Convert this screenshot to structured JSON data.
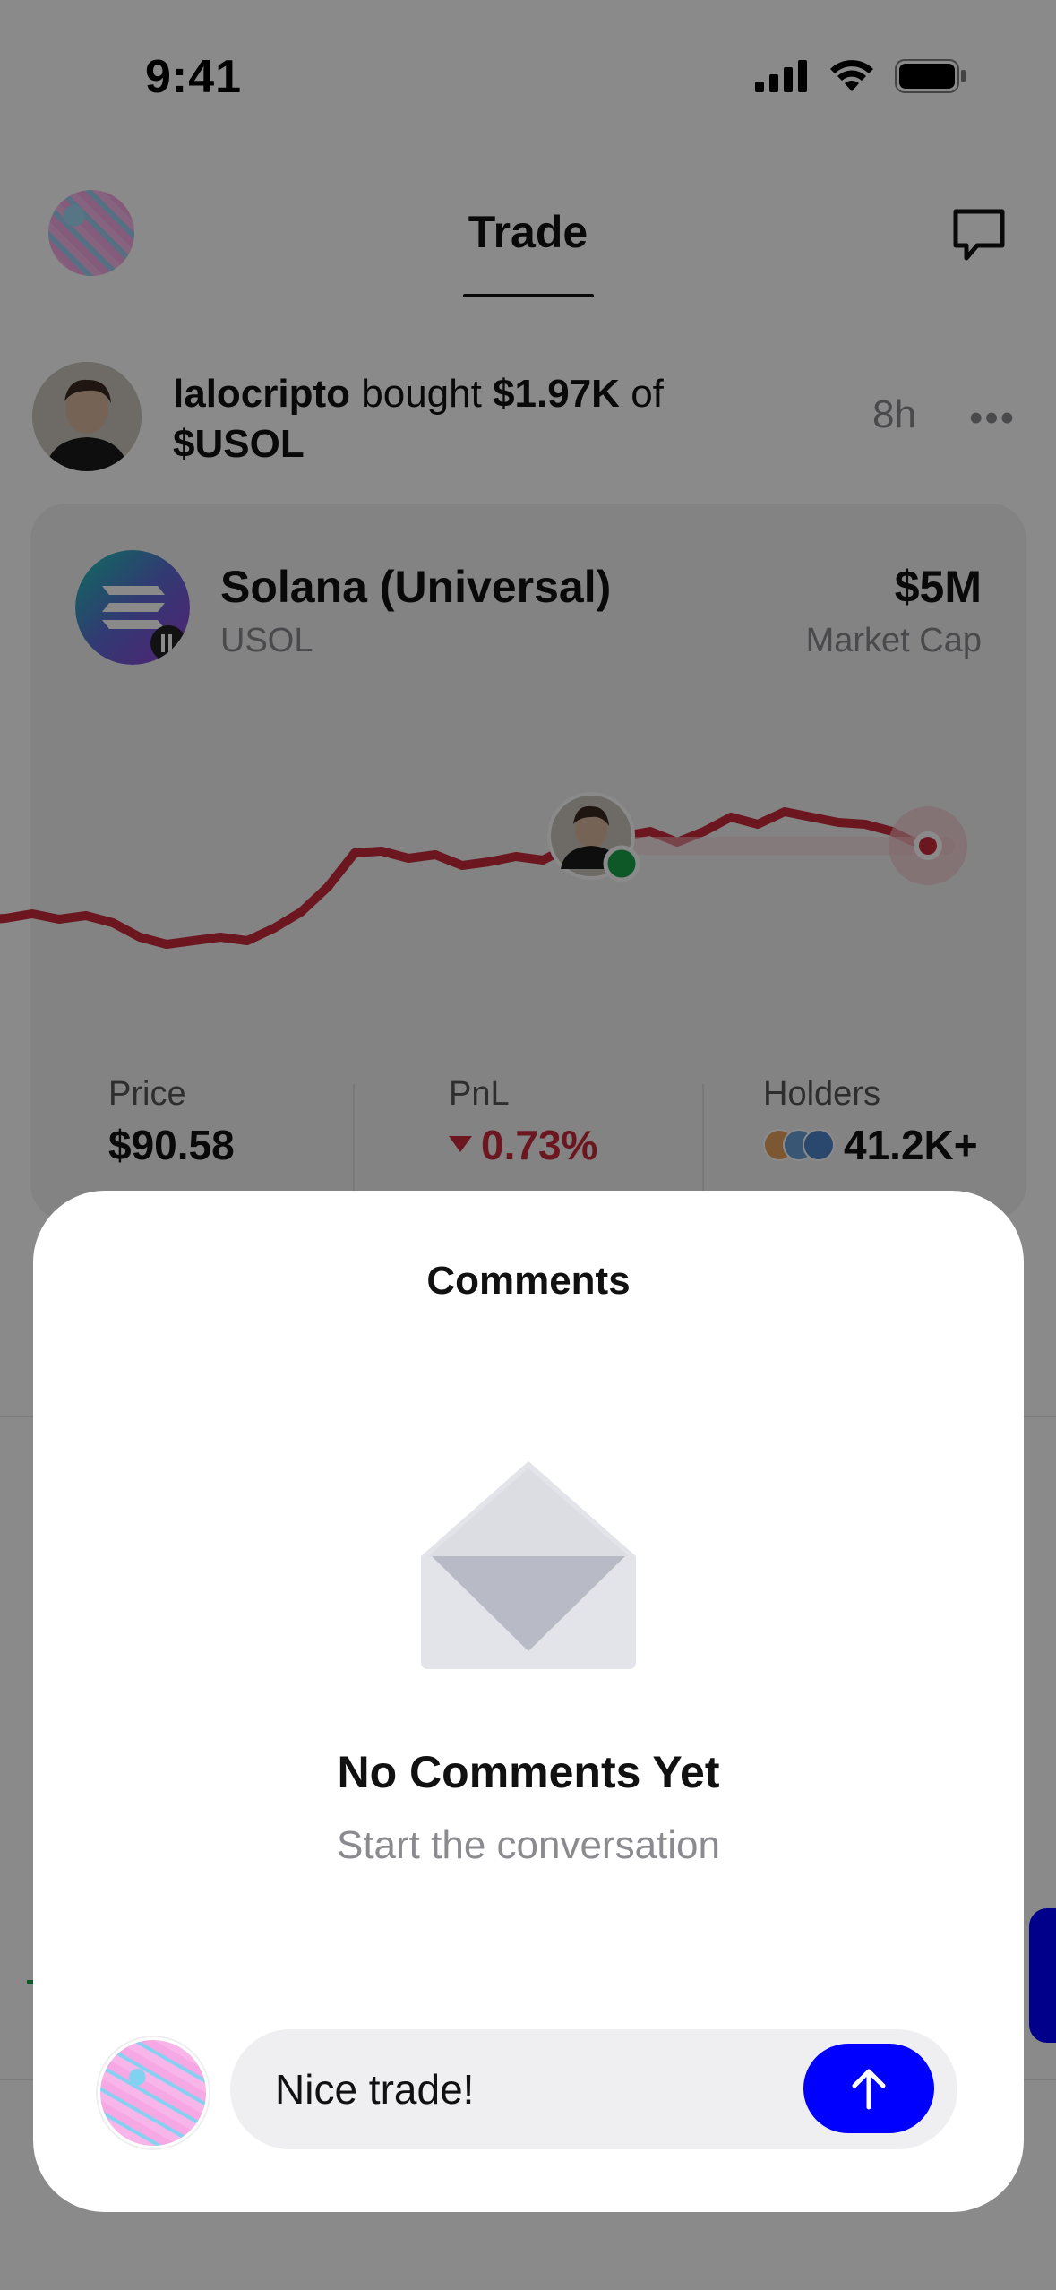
{
  "status_bar": {
    "time": "9:41"
  },
  "header": {
    "title": "Trade"
  },
  "activity": {
    "username": "lalocripto",
    "action": "bought",
    "amount": "$1.97K",
    "preposition": "of",
    "token": "$USOL",
    "time": "8h",
    "more": "•••"
  },
  "token_card": {
    "name": "Solana (Universal)",
    "ticker": "USOL",
    "market_cap_value": "$5M",
    "market_cap_label": "Market Cap",
    "line_color": "#c72b3a",
    "stats": {
      "price_label": "Price",
      "price_value": "$90.58",
      "pnl_label": "PnL",
      "pnl_value": "0.73%",
      "holders_label": "Holders",
      "holders_value": "41.2K+"
    }
  },
  "comments_modal": {
    "title": "Comments",
    "empty_title": "No Comments Yet",
    "empty_subtitle": "Start the conversation",
    "input_value": "Nice trade!",
    "send_color": "#0000ff"
  }
}
